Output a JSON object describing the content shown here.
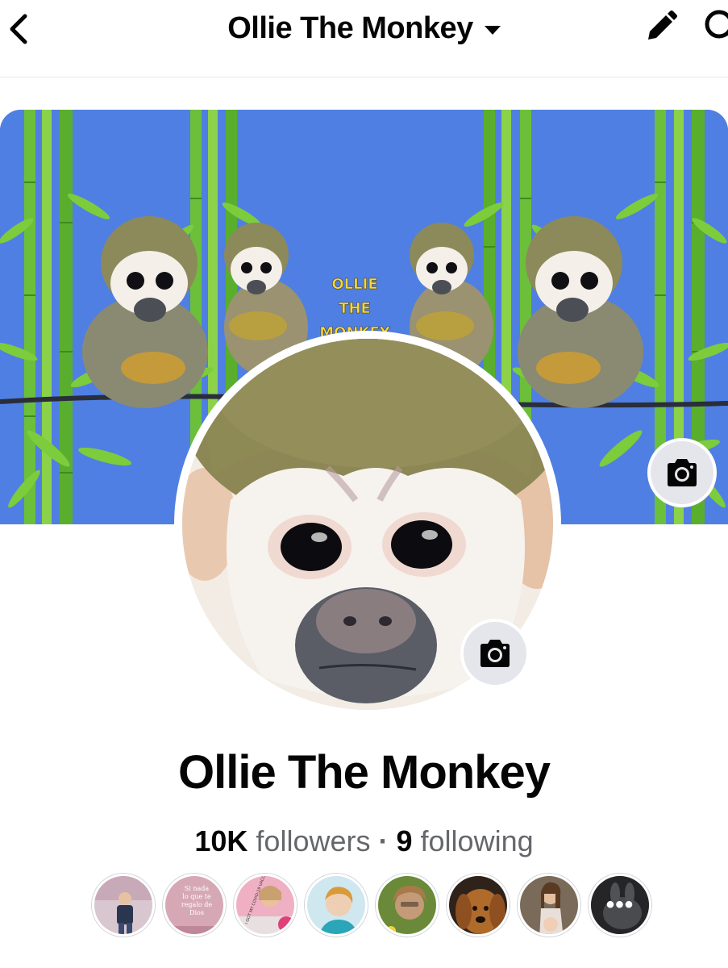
{
  "header": {
    "title": "Ollie The Monkey",
    "back_icon": "chevron-left-icon",
    "edit_icon": "pencil-icon",
    "search_icon": "search-icon"
  },
  "cover": {
    "text_lines": [
      "OLLIE",
      "THE",
      "MONKEY"
    ],
    "background_color": "#4f7fe2",
    "camera_icon": "camera-icon"
  },
  "profile": {
    "name": "Ollie The Monkey",
    "camera_icon": "camera-icon"
  },
  "stats": {
    "followers_count": "10K",
    "followers_label": "followers",
    "separator": "·",
    "following_count": "9",
    "following_label": "following"
  },
  "follower_avatars": {
    "count_visible": 8,
    "more_indicator": "•••",
    "post_text_2": [
      "Si nada",
      "lo que te",
      "regalo de",
      "Dios"
    ],
    "post_text_3": [
      "I GOT MY COVID-19 VACCINE"
    ]
  },
  "colors": {
    "text_primary": "#050505",
    "text_secondary": "#65676b",
    "button_gray": "#e4e6eb"
  }
}
